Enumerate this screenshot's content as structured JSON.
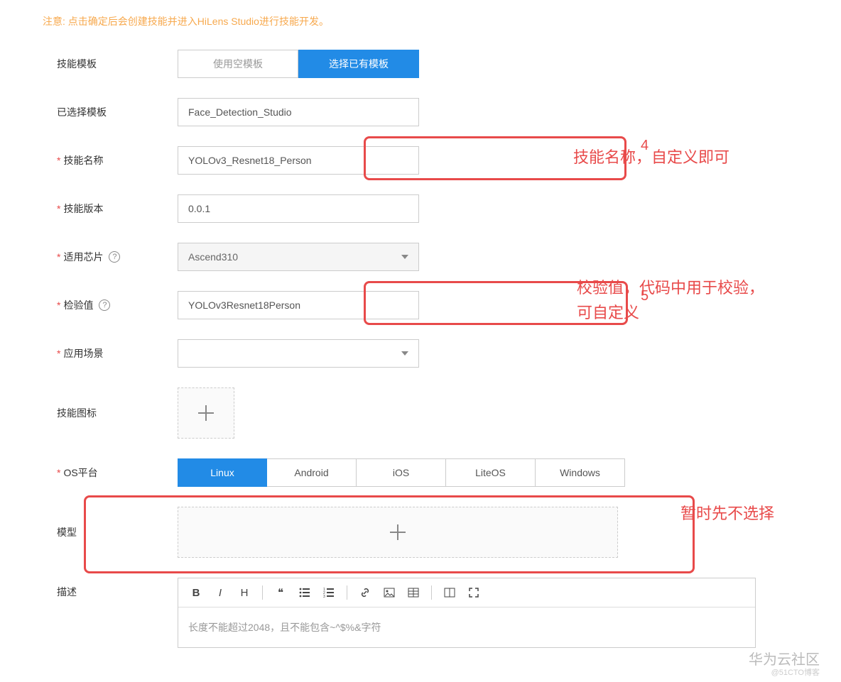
{
  "notice": "注意: 点击确定后会创建技能并进入HiLens Studio进行技能开发。",
  "fields": {
    "skillTemplate": {
      "label": "技能模板",
      "options": [
        "使用空模板",
        "选择已有模板"
      ],
      "selectedIndex": 1
    },
    "selectedTemplate": {
      "label": "已选择模板",
      "value": "Face_Detection_Studio"
    },
    "skillName": {
      "label": "技能名称",
      "value": "YOLOv3_Resnet18_Person"
    },
    "skillVersion": {
      "label": "技能版本",
      "value": "0.0.1"
    },
    "chip": {
      "label": "适用芯片",
      "value": "Ascend310"
    },
    "checkValue": {
      "label": "检验值",
      "value": "YOLOv3Resnet18Person"
    },
    "scene": {
      "label": "应用场景",
      "value": ""
    },
    "skillIcon": {
      "label": "技能图标"
    },
    "osPlatform": {
      "label": "OS平台",
      "options": [
        "Linux",
        "Android",
        "iOS",
        "LiteOS",
        "Windows"
      ],
      "selectedIndex": 0
    },
    "model": {
      "label": "模型"
    },
    "desc": {
      "label": "描述",
      "placeholder": "长度不能超过2048，且不能包含~^$%&字符"
    }
  },
  "annotations": {
    "num4": "4",
    "num5": "5",
    "note4": "技能名称，自定义即可",
    "note5": "校验值，代码中用于校验，可自定义",
    "noteModel": "暂时先不选择"
  },
  "watermark": {
    "main": "华为云社区",
    "sub": "@51CTO博客"
  }
}
